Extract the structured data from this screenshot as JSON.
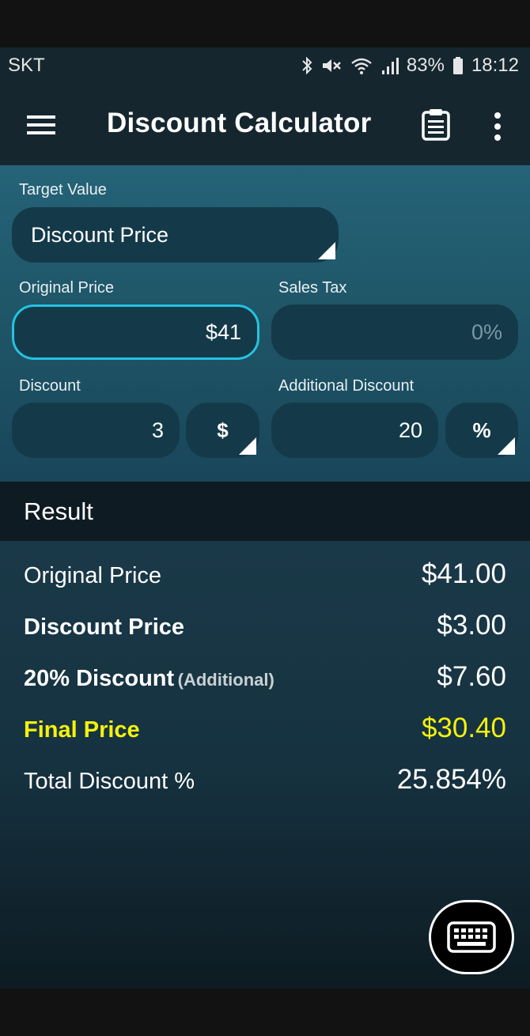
{
  "status_bar": {
    "carrier": "SKT",
    "battery": "83%",
    "time": "18:12"
  },
  "app_bar": {
    "title": "Discount Calculator",
    "icons": [
      "menu-icon",
      "clipboard-icon",
      "more-vert-icon"
    ]
  },
  "inputs": {
    "target_value_label": "Target Value",
    "target_value": "Discount Price",
    "original_price_label": "Original Price",
    "original_price_value": "$41",
    "sales_tax_label": "Sales Tax",
    "sales_tax_placeholder": "0%",
    "discount_label": "Discount",
    "discount_value": "3",
    "discount_unit": "$",
    "additional_discount_label": "Additional Discount",
    "additional_discount_value": "20",
    "additional_discount_unit": "%"
  },
  "result": {
    "header": "Result",
    "rows": [
      {
        "label": "Original Price",
        "value": "$41.00"
      },
      {
        "label": "Discount Price",
        "value": "$3.00"
      },
      {
        "label": "20% Discount",
        "sub": "(Additional)",
        "value": "$7.60"
      },
      {
        "label": "Final Price",
        "value": "$30.40"
      },
      {
        "label": "Total Discount %",
        "value": "25.854%"
      }
    ]
  },
  "colors": {
    "accent": "#24c2e0",
    "highlight": "#f4f10f",
    "panel": "#1f5668",
    "background": "#15262f"
  }
}
